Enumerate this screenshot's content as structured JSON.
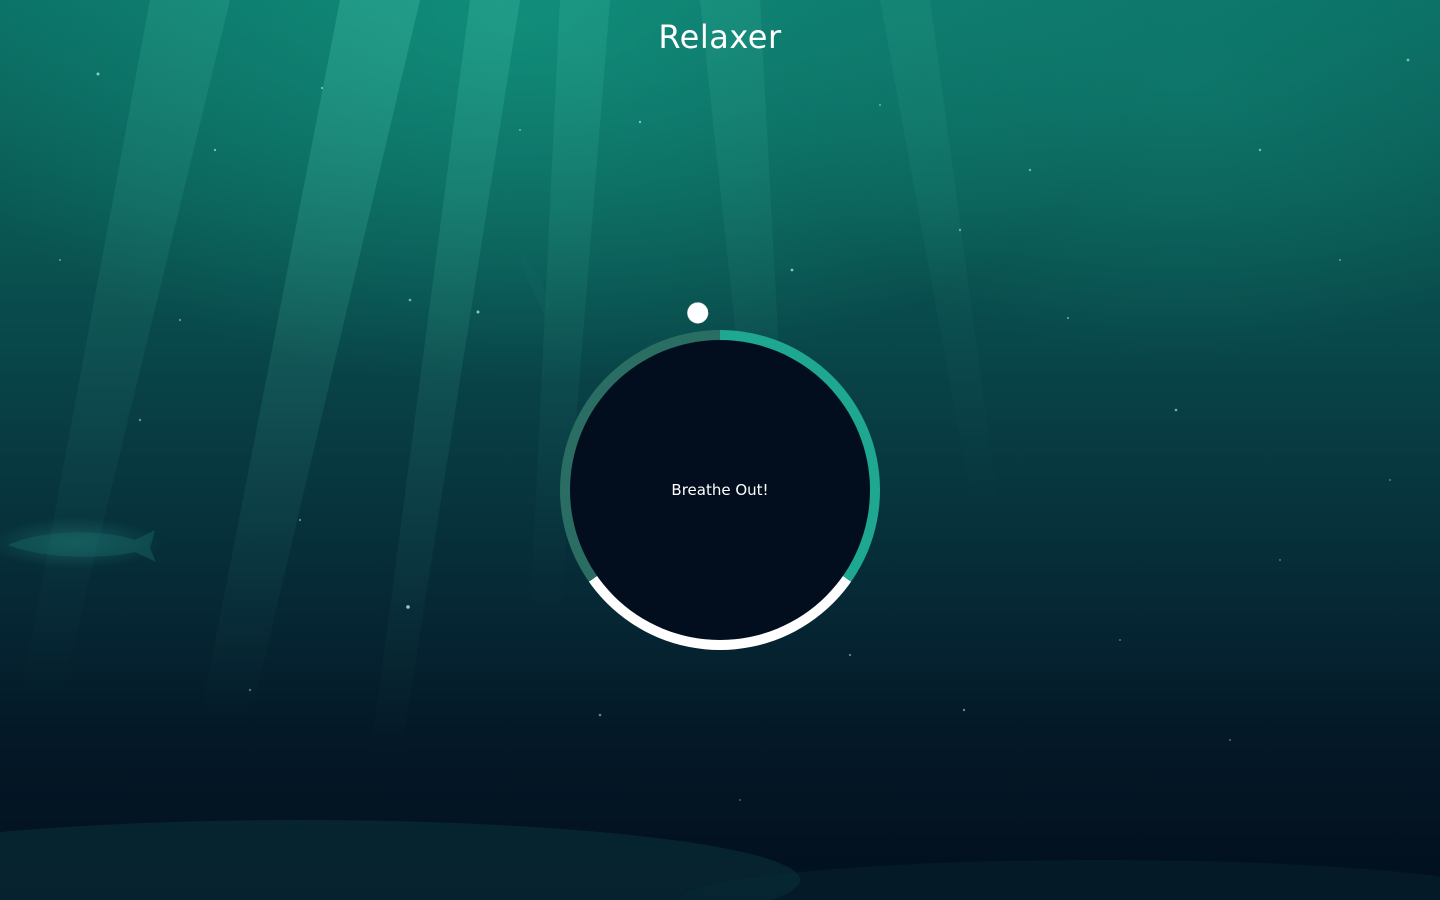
{
  "app": {
    "title": "Relaxer"
  },
  "breathing": {
    "instruction": "Breathe Out!"
  },
  "theme": {
    "ring_accent": "#1fa891",
    "ring_dim": "#2a6e63",
    "ring_highlight": "#ffffff",
    "circle_fill": "#020e1e"
  },
  "background": {
    "description_icon": "underwater-scene"
  }
}
